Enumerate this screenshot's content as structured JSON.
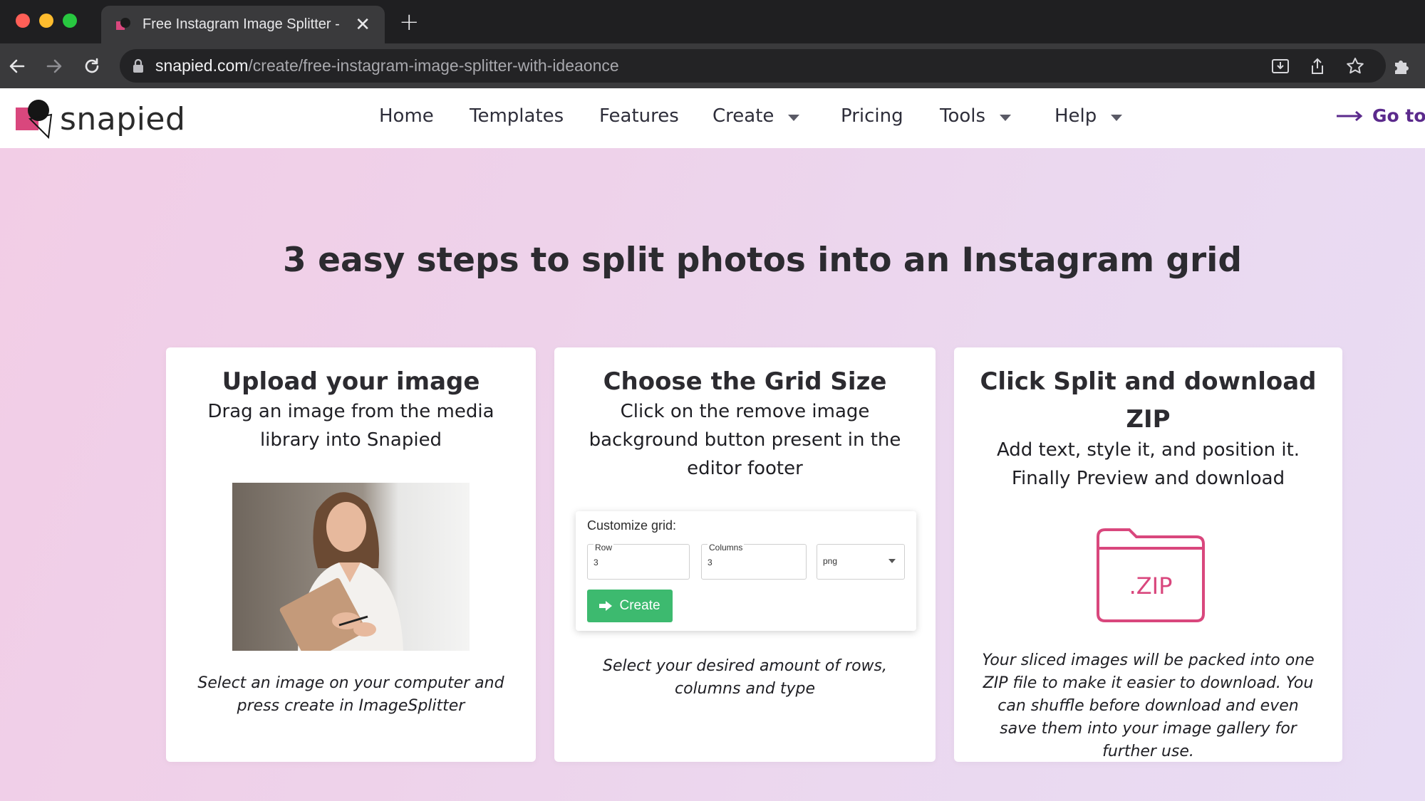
{
  "browser": {
    "tab_title": "Free Instagram Image Splitter -",
    "url_host": "snapied.com",
    "url_path": "/create/free-instagram-image-splitter-with-ideaonce"
  },
  "site": {
    "logo_text": "snapied",
    "nav": [
      {
        "label": "Home",
        "dropdown": false
      },
      {
        "label": "Templates",
        "dropdown": false
      },
      {
        "label": "Features",
        "dropdown": false
      },
      {
        "label": "Create",
        "dropdown": true
      },
      {
        "label": "Pricing",
        "dropdown": false
      },
      {
        "label": "Tools",
        "dropdown": true
      },
      {
        "label": "Help",
        "dropdown": true
      }
    ],
    "goto_label": "Go to d"
  },
  "hero": {
    "title": "3 easy steps to split photos into an Instagram grid"
  },
  "cards": [
    {
      "title": "Upload your image",
      "subtitle": "Drag an image from the media library into Snapied",
      "footer": "Select an image on your computer and press create in ImageSplitter"
    },
    {
      "title": "Choose the Grid Size",
      "subtitle": "Click on the remove image background button present in the editor footer",
      "footer": "Select your desired amount of rows, columns and type"
    },
    {
      "title": "Click Split and download ZIP",
      "subtitle": "Add text, style it, and position it. Finally Preview and download",
      "footer": "Your sliced images will be packed into one ZIP file to make it easier to download. You can shuffle before download and even save them into your image gallery for further use."
    }
  ],
  "grid_form": {
    "label": "Customize grid:",
    "row_label": "Row",
    "row_value": "3",
    "columns_label": "Columns",
    "columns_value": "3",
    "type_value": "png",
    "create_label": "Create"
  },
  "zip_icon_text": ".ZIP",
  "colors": {
    "accent_purple": "#5b2a8c",
    "create_green": "#3dba6f",
    "zip_pink": "#d9477d",
    "hero_bg": "#eed2ea"
  }
}
